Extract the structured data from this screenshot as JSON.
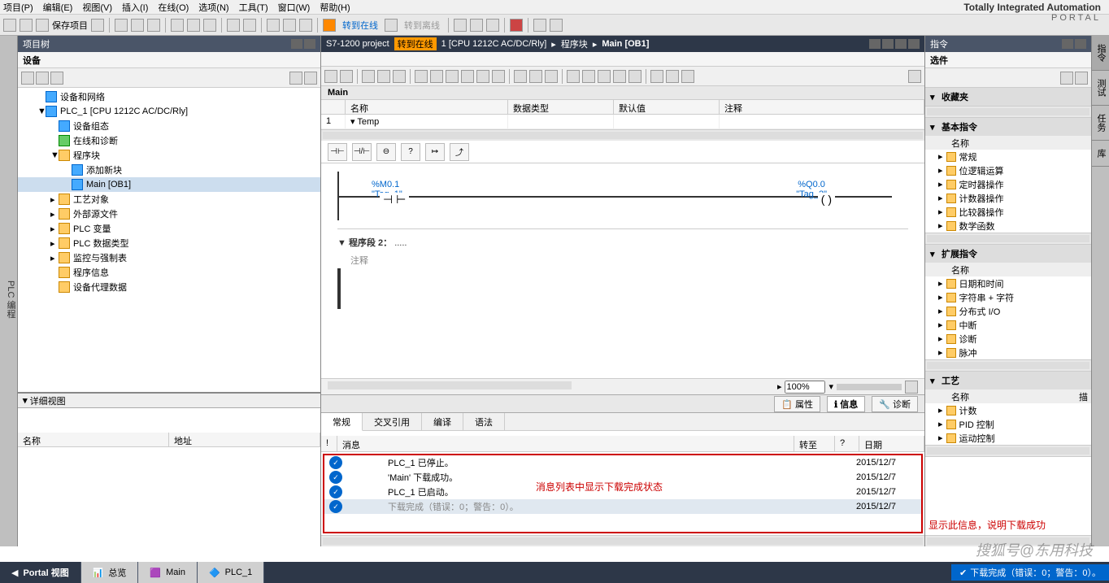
{
  "menu": [
    "项目(P)",
    "编辑(E)",
    "视图(V)",
    "插入(I)",
    "在线(O)",
    "选项(N)",
    "工具(T)",
    "窗口(W)",
    "帮助(H)"
  ],
  "brand": {
    "line1": "Totally Integrated Automation",
    "line2": "PORTAL"
  },
  "toolbar": {
    "save": "保存项目",
    "go_online": "转到在线",
    "go_offline": "转到离线"
  },
  "left": {
    "title": "项目树",
    "sub": "设备",
    "side_label": "PLC 编程",
    "tree": [
      {
        "lvl": 1,
        "exp": "",
        "ico": "blue",
        "label": "设备和网络"
      },
      {
        "lvl": 1,
        "exp": "▼",
        "ico": "blue",
        "label": "PLC_1 [CPU 1212C AC/DC/Rly]"
      },
      {
        "lvl": 2,
        "exp": "",
        "ico": "blue",
        "label": "设备组态"
      },
      {
        "lvl": 2,
        "exp": "",
        "ico": "grn",
        "label": "在线和诊断"
      },
      {
        "lvl": 2,
        "exp": "▼",
        "ico": "",
        "label": "程序块"
      },
      {
        "lvl": 3,
        "exp": "",
        "ico": "blue",
        "label": "添加新块"
      },
      {
        "lvl": 3,
        "exp": "",
        "ico": "blue",
        "label": "Main [OB1]",
        "sel": true
      },
      {
        "lvl": 2,
        "exp": "▸",
        "ico": "",
        "label": "工艺对象"
      },
      {
        "lvl": 2,
        "exp": "▸",
        "ico": "",
        "label": "外部源文件"
      },
      {
        "lvl": 2,
        "exp": "▸",
        "ico": "",
        "label": "PLC 变量"
      },
      {
        "lvl": 2,
        "exp": "▸",
        "ico": "",
        "label": "PLC 数据类型"
      },
      {
        "lvl": 2,
        "exp": "▸",
        "ico": "",
        "label": "监控与强制表"
      },
      {
        "lvl": 2,
        "exp": "",
        "ico": "",
        "label": "程序信息"
      },
      {
        "lvl": 2,
        "exp": "",
        "ico": "",
        "label": "设备代理数据"
      }
    ],
    "detail_title": "详细视图",
    "detail_cols": [
      "名称",
      "地址"
    ]
  },
  "center": {
    "title_prefix": "S7-1200 project",
    "online_badge": "转到在线",
    "title_suffix": "1 [CPU 1212C AC/DC/Rly]",
    "crumbs": [
      "程序块",
      "Main [OB1]"
    ],
    "block_name": "Main",
    "var_cols": [
      "",
      "名称",
      "数据类型",
      "默认值",
      "注释"
    ],
    "var_row": {
      "idx": "1",
      "name": "Temp"
    },
    "ladder_btns": [
      "⊣⊢",
      "⊣/⊢",
      "⊖",
      "?",
      "↦",
      "⤴"
    ],
    "tag1_addr": "%M0.1",
    "tag1_name": "\"Tag_1\"",
    "tag2_addr": "%Q0.0",
    "tag2_name": "\"Tag_2\"",
    "network2": "程序段 2：",
    "comment": "注释",
    "zoom": "100%",
    "prop_tabs": [
      "属性",
      "信息",
      "诊断"
    ],
    "msg_tabs": [
      "常规",
      "交叉引用",
      "编译",
      "语法"
    ],
    "msg_cols": {
      "exc": "!",
      "msg": "消息",
      "goto": "转至",
      "q": "?",
      "date": "日期"
    },
    "messages": [
      {
        "text": "PLC_1 已停止。",
        "date": "2015/12/7"
      },
      {
        "text": "'Main' 下载成功。",
        "date": "2015/12/7"
      },
      {
        "text": "PLC_1 已启动。",
        "date": "2015/12/7"
      },
      {
        "text": "下载完成（错误：0；警告：0）。",
        "date": "2015/12/7",
        "dim": true
      }
    ],
    "msg_note": "消息列表中显示下载完成状态"
  },
  "right": {
    "title": "指令",
    "sub": "选件",
    "tabs": [
      "指令",
      "测试",
      "任务",
      "库"
    ],
    "sections": [
      {
        "title": "收藏夹",
        "items": []
      },
      {
        "title": "基本指令",
        "col": "名称",
        "items": [
          "常规",
          "位逻辑运算",
          "定时器操作",
          "计数器操作",
          "比较器操作",
          "数学函数"
        ]
      },
      {
        "title": "扩展指令",
        "col": "名称",
        "items": [
          "日期和时间",
          "字符串 + 字符",
          "分布式 I/O",
          "中断",
          "诊断",
          "脉冲"
        ]
      },
      {
        "title": "工艺",
        "col": "名称",
        "col2": "描",
        "items": [
          "计数",
          "PID 控制",
          "运动控制"
        ]
      }
    ],
    "note": "显示此信息，说明下载成功"
  },
  "bottom": {
    "portal": "Portal 视图",
    "overview": "总览",
    "main": "Main",
    "plc": "PLC_1",
    "status": "下载完成（错误：0；警告：0）。"
  },
  "watermark": "搜狐号@东用科技"
}
